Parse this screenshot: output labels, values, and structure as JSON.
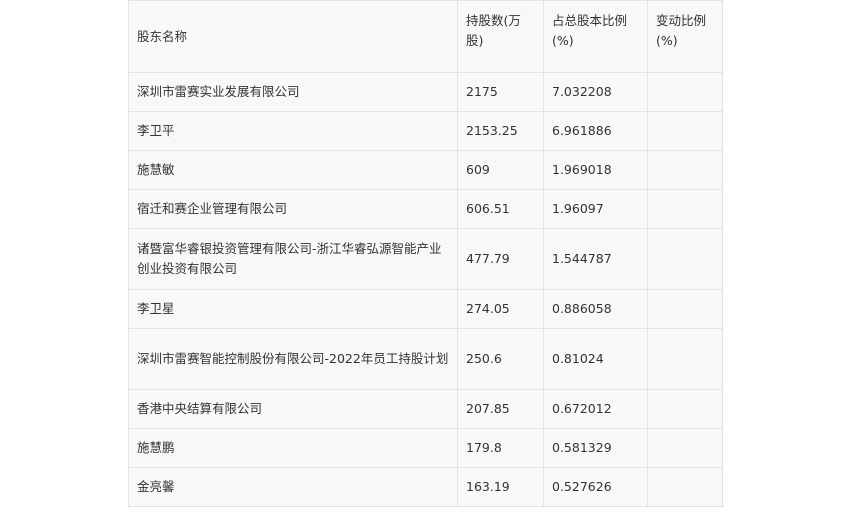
{
  "table": {
    "headers": [
      "股东名称",
      "持股数(万股)",
      "占总股本比例(%)",
      "变动比例(%)"
    ],
    "rows": [
      {
        "name": "深圳市雷赛实业发展有限公司",
        "shares": "2175",
        "ratio": "7.032208",
        "change": ""
      },
      {
        "name": "李卫平",
        "shares": "2153.25",
        "ratio": "6.961886",
        "change": ""
      },
      {
        "name": "施慧敏",
        "shares": "609",
        "ratio": "1.969018",
        "change": ""
      },
      {
        "name": "宿迁和赛企业管理有限公司",
        "shares": "606.51",
        "ratio": "1.96097",
        "change": ""
      },
      {
        "name": "诸暨富华睿银投资管理有限公司-浙江华睿弘源智能产业创业投资有限公司",
        "shares": "477.79",
        "ratio": "1.544787",
        "change": ""
      },
      {
        "name": "李卫星",
        "shares": "274.05",
        "ratio": "0.886058",
        "change": ""
      },
      {
        "name": "深圳市雷赛智能控制股份有限公司-2022年员工持股计划",
        "shares": "250.6",
        "ratio": "0.81024",
        "change": ""
      },
      {
        "name": "香港中央结算有限公司",
        "shares": "207.85",
        "ratio": "0.672012",
        "change": ""
      },
      {
        "name": "施慧鹏",
        "shares": "179.8",
        "ratio": "0.581329",
        "change": ""
      },
      {
        "name": "金亮馨",
        "shares": "163.19",
        "ratio": "0.527626",
        "change": ""
      }
    ]
  }
}
